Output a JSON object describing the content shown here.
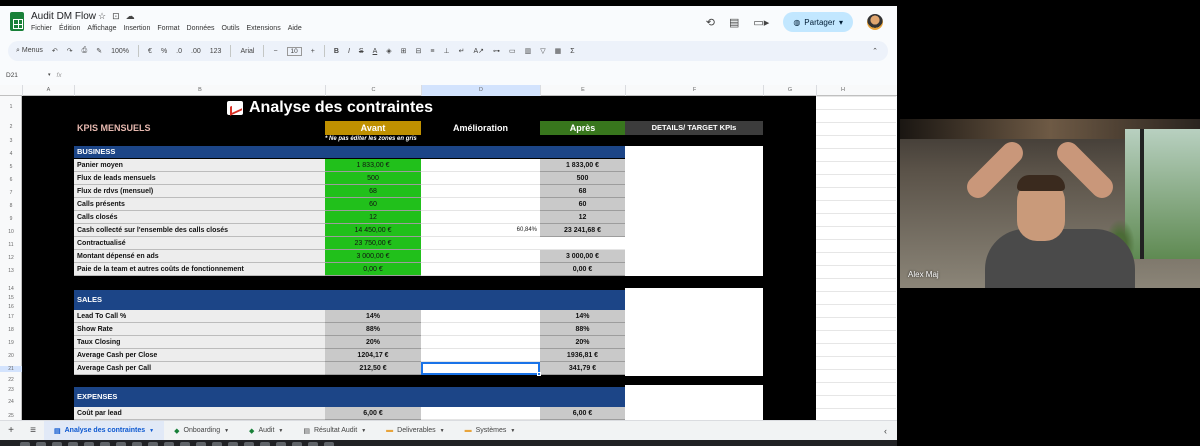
{
  "app": {
    "doc_title": "Audit DM Flow",
    "menu": [
      "Fichier",
      "Édition",
      "Affichage",
      "Insertion",
      "Format",
      "Données",
      "Outils",
      "Extensions",
      "Aide"
    ],
    "share_label": "Partager"
  },
  "toolbar": {
    "menus_label": "Menus",
    "zoom": "100%",
    "currency": "€",
    "percent": "%",
    "dec_less": ".0",
    "dec_more": ".00",
    "number_format": "123",
    "font": "Arial",
    "font_size": "10"
  },
  "formula_bar": {
    "cell_ref": "D21",
    "fx": "fx"
  },
  "columns": [
    "A",
    "B",
    "C",
    "D",
    "E",
    "F",
    "G",
    "H"
  ],
  "rows": [
    "1",
    "2",
    "3",
    "4",
    "5",
    "6",
    "7",
    "8",
    "9",
    "10",
    "11",
    "12",
    "13",
    "14",
    "15",
    "16",
    "17",
    "18",
    "19",
    "20",
    "21",
    "22",
    "23",
    "24",
    "25"
  ],
  "sheet": {
    "title": "Analyse des contraintes",
    "headers": {
      "kpis": "KPIS MENSUELS",
      "avant": "Avant",
      "amelioration": "Amélioration",
      "apres": "Après",
      "details": "DETAILS/ TARGET KPIs"
    },
    "note": "* Ne pas éditer les zones en gris",
    "business": {
      "title": "BUSINESS",
      "rows": [
        {
          "label": "Panier moyen",
          "avant": "1 833,00 €",
          "amelioration": "",
          "apres": "1 833,00 €"
        },
        {
          "label": "Flux de leads mensuels",
          "avant": "500",
          "amelioration": "",
          "apres": "500"
        },
        {
          "label": "Flux de rdvs (mensuel)",
          "avant": "68",
          "amelioration": "",
          "apres": "68"
        },
        {
          "label": "Calls présents",
          "avant": "60",
          "amelioration": "",
          "apres": "60"
        },
        {
          "label": "Calls closés",
          "avant": "12",
          "amelioration": "",
          "apres": "12"
        },
        {
          "label": "Cash collecté sur l'ensemble des calls closés",
          "avant": "14 450,00 €",
          "amelioration": "60,84%",
          "apres": "23 241,68 €"
        },
        {
          "label": "Contractualisé",
          "avant": "23 750,00 €",
          "amelioration": "",
          "apres": ""
        },
        {
          "label": "Montant dépensé en ads",
          "avant": "3 000,00 €",
          "amelioration": "",
          "apres": "3 000,00 €"
        },
        {
          "label": "Paie de la team et autres coûts de fonctionnement",
          "avant": "0,00 €",
          "amelioration": "",
          "apres": "0,00 €"
        }
      ]
    },
    "sales": {
      "title": "SALES",
      "rows": [
        {
          "label": "Lead To Call %",
          "avant": "14%",
          "amelioration": "",
          "apres": "14%"
        },
        {
          "label": "Show Rate",
          "avant": "88%",
          "amelioration": "",
          "apres": "88%"
        },
        {
          "label": "Taux Closing",
          "avant": "20%",
          "amelioration": "",
          "apres": "20%"
        },
        {
          "label": "Average Cash per Close",
          "avant": "1204,17 €",
          "amelioration": "",
          "apres": "1936,81 €"
        },
        {
          "label": "Average Cash per Call",
          "avant": "212,50 €",
          "amelioration": "",
          "apres": "341,79 €"
        }
      ]
    },
    "expenses": {
      "title": "EXPENSES",
      "rows": [
        {
          "label": "Coût par lead",
          "avant": "6,00 €",
          "amelioration": "",
          "apres": "6,00 €"
        }
      ]
    }
  },
  "tabs": [
    {
      "label": "Analyse des contraintes",
      "active": true
    },
    {
      "label": "Onboarding",
      "active": false
    },
    {
      "label": "Audit",
      "active": false
    },
    {
      "label": "Résultat Audit",
      "active": false
    },
    {
      "label": "Deliverables",
      "active": false
    },
    {
      "label": "Systèmes",
      "active": false
    }
  ],
  "video": {
    "participant_name": "Alex Maj"
  },
  "colors": {
    "header_blue": "#1c4587",
    "avant_gold": "#bf9000",
    "apres_green": "#38761d",
    "input_green": "#21c01b",
    "locked_grey": "#c9c9c9",
    "kpi_label": "#e6b8af"
  }
}
